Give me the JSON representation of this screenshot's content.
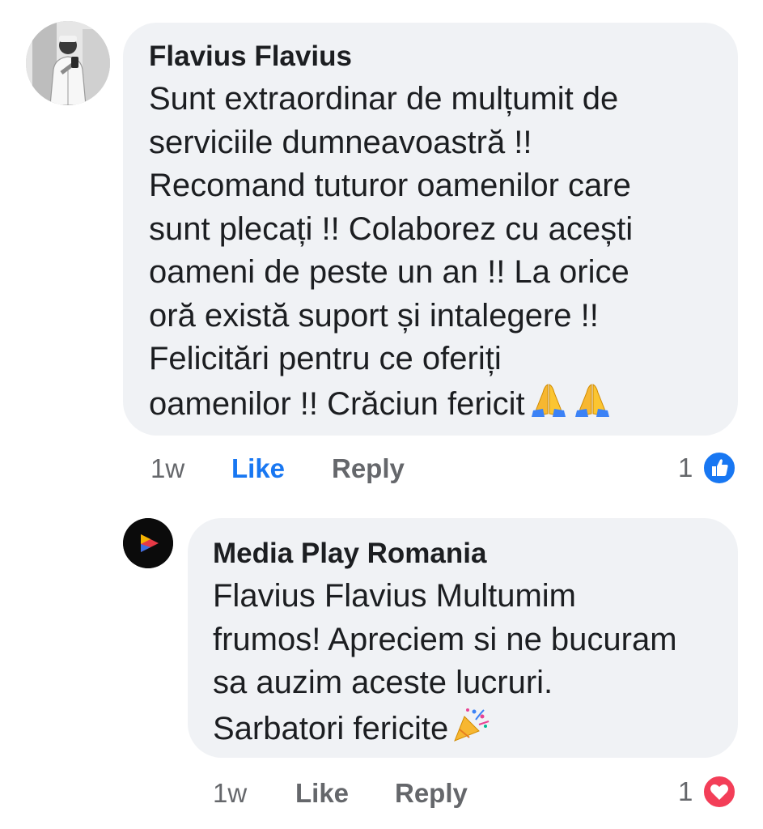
{
  "comments": [
    {
      "author": "Flavius Flavius",
      "lines": [
        "Sunt extraordinar de mulțumit de",
        "serviciile dumneavoastră !!",
        "Recomand tuturor oamenilor care",
        "sunt plecați !! Colaborez cu acești",
        "oameni de peste un an !! La orice",
        "oră există suport și intalegere !!",
        "Felicitări pentru ce oferiți",
        "oamenilor !! Crăciun fericit"
      ],
      "emojis": [
        "folded-hands-icon",
        "folded-hands-icon"
      ],
      "time": "1w",
      "like_label": "Like",
      "reply_label": "Reply",
      "reaction_count": "1",
      "reaction_type": "like",
      "like_active": true
    },
    {
      "author": "Media Play Romania",
      "lines": [
        "Flavius Flavius Multumim",
        "frumos! Apreciem si ne bucuram",
        "sa auzim aceste lucruri.",
        "Sarbatori fericite"
      ],
      "emojis": [
        "party-popper-icon"
      ],
      "time": "1w",
      "like_label": "Like",
      "reply_label": "Reply",
      "reaction_count": "1",
      "reaction_type": "love",
      "like_active": false
    }
  ],
  "colors": {
    "bubble": "#f0f2f5",
    "like_blue": "#1877f2",
    "love_red": "#f33e58",
    "meta_gray": "#65676b",
    "text": "#1c1e21"
  }
}
